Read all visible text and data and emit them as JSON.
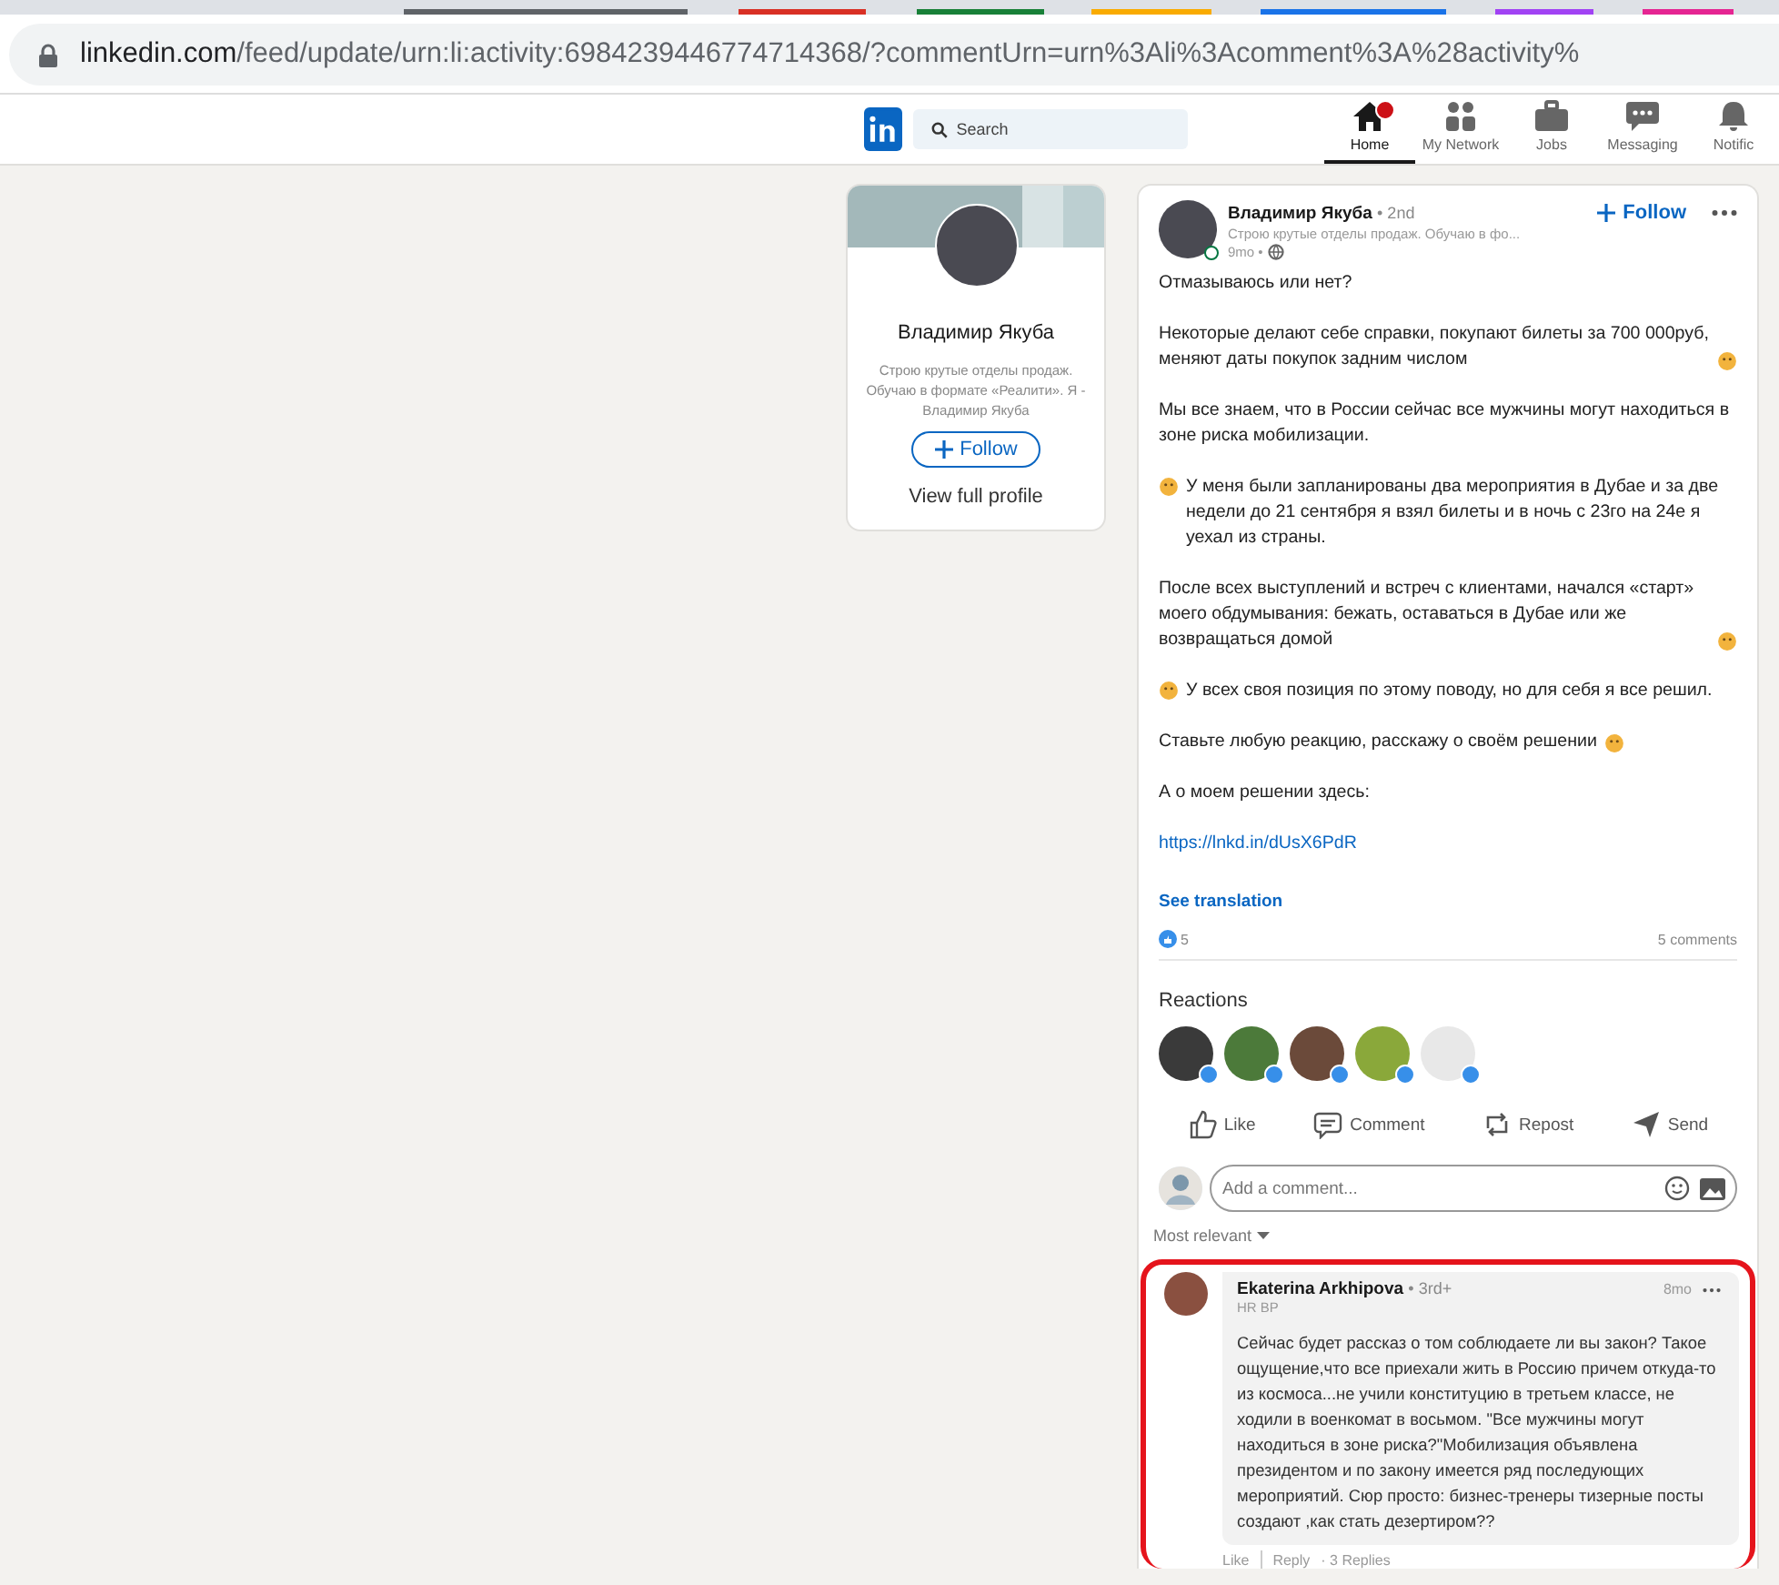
{
  "browser": {
    "url_host": "linkedin.com",
    "url_path": "/feed/update/urn:li:activity:6984239446774714368/?commentUrn=urn%3Ali%3Acomment%3A%28activity%"
  },
  "nav": {
    "search_placeholder": "Search",
    "items": [
      {
        "label": "Home",
        "selected": true,
        "badge": true,
        "kind": "home"
      },
      {
        "label": "My Network",
        "selected": false,
        "badge": false,
        "kind": "network"
      },
      {
        "label": "Jobs",
        "selected": false,
        "badge": false,
        "kind": "jobs"
      },
      {
        "label": "Messaging",
        "selected": false,
        "badge": false,
        "kind": "messaging"
      },
      {
        "label": "Notific",
        "selected": false,
        "badge": false,
        "kind": "bell"
      }
    ]
  },
  "profile_card": {
    "name": "Владимир Якуба",
    "headline": "Строю крутые отделы продаж. Обучаю в формате «Реалити». Я - Владимир Якуба",
    "follow": "Follow",
    "view_profile": "View full profile"
  },
  "post": {
    "author": "Владимир Якуба",
    "degree": "• 2nd",
    "headline": "Строю крутые отделы продаж. Обучаю в фо...",
    "time": "9mo •",
    "follow": "Follow",
    "paragraphs": [
      {
        "kind": "plain",
        "text": "Отмазываюсь или нет?"
      },
      {
        "kind": "icon_end",
        "text": "Некоторые делают себе справки, покупают билеты за 700 000руб, меняют даты покупок задним числом"
      },
      {
        "kind": "plain",
        "text": "Мы все знаем, что в России сейчас все мужчины могут находиться в зоне риска мобилизации."
      },
      {
        "kind": "icon_start",
        "text": "У меня были запланированы два мероприятия в Дубае и за две недели до 21 сентября я взял билеты и в ночь с 23го на 24е я уехал из страны."
      },
      {
        "kind": "icon_end",
        "text": "После всех выступлений и встреч с клиентами, начался «старт» моего обдумывания: бежать, оставаться в Дубае или же возвращаться домой"
      },
      {
        "kind": "icon_start",
        "text": "У всех своя позиция по этому поводу, но для себя я все решил."
      },
      {
        "kind": "icon_end",
        "text": "Ставьте любую реакцию, расскажу о своём решении"
      },
      {
        "kind": "plain",
        "text": "А о моем решении здесь:"
      },
      {
        "kind": "link",
        "text": "https://lnkd.in/dUsX6PdR"
      }
    ],
    "see_translation": "See translation",
    "reactions_count": "5",
    "comments_count": "5 comments",
    "reactions_title": "Reactions",
    "reactors": [
      {
        "color": "#3a3a3a"
      },
      {
        "color": "#4c7a3a"
      },
      {
        "color": "#6b4a3a"
      },
      {
        "color": "#8aa83a"
      },
      {
        "color": "#e8e8e8"
      }
    ],
    "actions": [
      {
        "label": "Like",
        "kind": "like"
      },
      {
        "label": "Comment",
        "kind": "comment"
      },
      {
        "label": "Repost",
        "kind": "repost"
      },
      {
        "label": "Send",
        "kind": "send"
      }
    ],
    "comment_placeholder": "Add a comment...",
    "sort": "Most relevant"
  },
  "comment": {
    "author": "Ekaterina Arkhipova",
    "degree": "• 3rd+",
    "headline": "HR BP",
    "time": "8mo",
    "text": "Сейчас будет рассказ о том соблюдаете ли вы закон? Такое ощущение,что все приехали жить в Россию причем откуда-то из космоса...не учили конституцию в третьем классе, не ходили в военкомат в восьмом. \"Все мужчины могут находиться в зоне риска?\"Мобилизация объявлена президентом и по закону имеется ряд последующих мероприятий. Сюр просто: бизнес-тренеры тизерные посты создают ,как стать дезертиром??",
    "like": "Like",
    "reply": "Reply",
    "replies": "· 3 Replies"
  }
}
